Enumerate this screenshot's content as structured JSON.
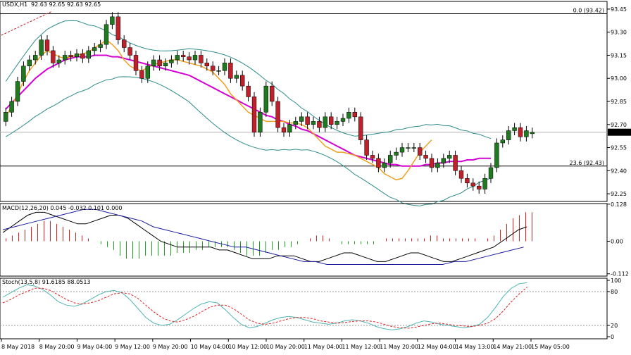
{
  "window": {
    "title": "USDX,H1",
    "ohlc": "92.63 92.65 92.63 92.65"
  },
  "colors": {
    "background": "#ffffff",
    "bull": "#1f7a1f",
    "bear": "#c0202a",
    "ma_slow": "#d400d4",
    "ma_fast": "#f0a020",
    "bands": "#2e8b8b",
    "macd_line": "#000000",
    "macd_signal": "#1a1a9e",
    "stoch_k": "#4fb3b3",
    "stoch_d": "#e02020",
    "hist_pos": "#e02020",
    "hist_neg": "#20a020"
  },
  "chart_data": [
    {
      "type": "candlestick",
      "title": "USDX,H1",
      "ylim": [
        92.2,
        93.5
      ],
      "y_ticks": [
        "93.45",
        "93.30",
        "93.15",
        "93.00",
        "92.85",
        "92.70",
        "92.55",
        "92.40",
        "92.25"
      ],
      "x_tick_labels": [
        "8 May 2018",
        "8 May 20:00",
        "9 May 04:00",
        "9 May 12:00",
        "9 May 20:00",
        "10 May 04:00",
        "10 May 12:00",
        "10 May 20:00",
        "11 May 04:00",
        "11 May 12:00",
        "11 May 20:00",
        "12 May 04:00",
        "14 May 13:00",
        "14 May 21:00",
        "15 May 05:00"
      ],
      "current_price": "92.65",
      "fibonacci": [
        {
          "label": "0.0 (93.42)",
          "value": 93.42
        },
        {
          "label": "23.6 (92.43)",
          "value": 92.43
        }
      ],
      "close": [
        92.78,
        92.85,
        92.98,
        93.08,
        93.12,
        93.15,
        93.25,
        93.18,
        93.1,
        93.12,
        93.15,
        93.14,
        93.16,
        93.13,
        93.18,
        93.2,
        93.22,
        93.35,
        93.4,
        93.25,
        93.2,
        93.15,
        93.05,
        93.0,
        93.08,
        93.12,
        93.08,
        93.1,
        93.12,
        93.15,
        93.14,
        93.12,
        93.15,
        93.1,
        93.08,
        93.05,
        93.05,
        93.1,
        93.0,
        93.02,
        92.95,
        92.88,
        92.65,
        92.78,
        92.95,
        92.85,
        92.68,
        92.65,
        92.7,
        92.72,
        92.75,
        92.7,
        92.72,
        92.68,
        92.75,
        92.7,
        92.72,
        92.74,
        92.78,
        92.75,
        92.6,
        92.5,
        92.48,
        92.42,
        92.45,
        92.5,
        92.52,
        92.55,
        92.55,
        92.55,
        92.5,
        92.48,
        92.42,
        92.45,
        92.48,
        92.5,
        92.4,
        92.35,
        92.32,
        92.3,
        92.28,
        92.35,
        92.42,
        92.58,
        92.6,
        92.66,
        92.68,
        92.62,
        92.66,
        92.65
      ],
      "open": [
        92.72,
        92.78,
        92.85,
        92.98,
        93.08,
        93.12,
        93.15,
        93.25,
        93.18,
        93.1,
        93.12,
        93.15,
        93.14,
        93.16,
        93.13,
        93.18,
        93.2,
        93.22,
        93.35,
        93.4,
        93.25,
        93.2,
        93.15,
        93.05,
        93.0,
        93.08,
        93.12,
        93.08,
        93.1,
        93.12,
        93.15,
        93.14,
        93.12,
        93.15,
        93.1,
        93.08,
        93.05,
        93.05,
        93.1,
        93.0,
        93.02,
        92.95,
        92.88,
        92.65,
        92.78,
        92.95,
        92.85,
        92.68,
        92.65,
        92.7,
        92.72,
        92.75,
        92.7,
        92.72,
        92.68,
        92.75,
        92.7,
        92.72,
        92.74,
        92.78,
        92.75,
        92.6,
        92.5,
        92.48,
        92.42,
        92.45,
        92.5,
        92.52,
        92.55,
        92.55,
        92.55,
        92.5,
        92.48,
        92.42,
        92.45,
        92.48,
        92.5,
        92.4,
        92.35,
        92.32,
        92.3,
        92.28,
        92.35,
        92.42,
        92.58,
        92.6,
        92.66,
        92.68,
        92.62,
        92.64
      ],
      "ma_slow": [
        92.8,
        92.84,
        92.88,
        92.92,
        92.96,
        93.0,
        93.03,
        93.06,
        93.08,
        93.1,
        93.12,
        93.13,
        93.14,
        93.14,
        93.14,
        93.15,
        93.15,
        93.15,
        93.14,
        93.14,
        93.13,
        93.12,
        93.11,
        93.1,
        93.09,
        93.08,
        93.07,
        93.06,
        93.05,
        93.04,
        93.03,
        93.02,
        93.0,
        92.98,
        92.96,
        92.94,
        92.92,
        92.9,
        92.88,
        92.86,
        92.84,
        92.82,
        92.8,
        92.78,
        92.76,
        92.75,
        92.73,
        92.72,
        92.7,
        92.69,
        92.67,
        92.66,
        92.64,
        92.62,
        92.6,
        92.58,
        92.56,
        92.54,
        92.52,
        92.5,
        92.49,
        92.48,
        92.47,
        92.46,
        92.45,
        92.44,
        92.44,
        92.43,
        92.43,
        92.43,
        92.43,
        92.44,
        92.44,
        92.45,
        92.45,
        92.46,
        92.46,
        92.46,
        92.47,
        92.47,
        92.48,
        92.48,
        92.48
      ],
      "ma_fast": [
        92.75,
        92.82,
        92.9,
        92.98,
        93.05,
        93.1,
        93.15,
        93.18,
        93.16,
        93.14,
        93.13,
        93.14,
        93.15,
        93.16,
        93.17,
        93.2,
        93.22,
        93.25,
        93.22,
        93.18,
        93.12,
        93.08,
        93.06,
        93.05,
        93.07,
        93.09,
        93.1,
        93.11,
        93.12,
        93.12,
        93.11,
        93.1,
        93.09,
        93.08,
        93.06,
        93.04,
        93.0,
        92.96,
        92.9,
        92.86,
        92.82,
        92.78,
        92.76,
        92.74,
        92.72,
        92.72,
        92.72,
        92.72,
        92.71,
        92.71,
        92.7,
        92.68,
        92.64,
        92.6,
        92.56,
        92.54,
        92.52,
        92.52,
        92.51,
        92.5,
        92.48,
        92.46,
        92.44,
        92.42,
        92.38,
        92.36,
        92.34,
        92.35,
        92.4,
        92.46,
        92.52,
        92.56,
        92.6
      ]
    },
    {
      "type": "line",
      "title": "MACD(12,26,20) 0.045 -0.032 0.101 0.000",
      "ylim": [
        -0.12,
        0.13
      ],
      "y_ticks": [
        "0.128",
        "0.00",
        "-0.112"
      ],
      "histogram": [
        0.01,
        0.02,
        0.03,
        0.04,
        0.05,
        0.06,
        0.07,
        0.07,
        0.06,
        0.05,
        0.04,
        0.03,
        0.02,
        0.01,
        0.0,
        -0.01,
        -0.02,
        -0.03,
        -0.05,
        -0.06,
        -0.06,
        -0.06,
        -0.05,
        -0.05,
        -0.05,
        -0.05,
        -0.05,
        -0.04,
        -0.04,
        -0.04,
        -0.03,
        -0.03,
        -0.02,
        -0.02,
        -0.02,
        -0.02,
        -0.03,
        -0.04,
        -0.05,
        -0.05,
        -0.05,
        -0.04,
        -0.03,
        -0.03,
        -0.02,
        -0.02,
        -0.01,
        0.0,
        0.01,
        0.02,
        0.02,
        0.01,
        0.0,
        -0.01,
        -0.01,
        -0.01,
        -0.01,
        -0.01,
        -0.01,
        0.0,
        0.01,
        0.01,
        0.01,
        0.01,
        0.01,
        0.01,
        0.01,
        0.02,
        0.02,
        0.01,
        0.01,
        0.01,
        0.01,
        0.01,
        0.01,
        0.0,
        0.01,
        0.02,
        0.04,
        0.06,
        0.08,
        0.09,
        0.1,
        0.1
      ],
      "macd": [
        0.03,
        0.05,
        0.07,
        0.09,
        0.1,
        0.1,
        0.09,
        0.08,
        0.07,
        0.06,
        0.06,
        0.07,
        0.08,
        0.09,
        0.09,
        0.08,
        0.06,
        0.04,
        0.02,
        0.0,
        -0.01,
        -0.02,
        -0.02,
        -0.02,
        -0.02,
        -0.02,
        -0.03,
        -0.03,
        -0.04,
        -0.05,
        -0.06,
        -0.06,
        -0.06,
        -0.05,
        -0.05,
        -0.05,
        -0.06,
        -0.07,
        -0.07,
        -0.06,
        -0.05,
        -0.04,
        -0.04,
        -0.05,
        -0.06,
        -0.07,
        -0.07,
        -0.06,
        -0.05,
        -0.04,
        -0.04,
        -0.05,
        -0.06,
        -0.07,
        -0.07,
        -0.06,
        -0.05,
        -0.04,
        -0.03,
        -0.02,
        0.0,
        0.02,
        0.04,
        0.05
      ],
      "signal": [
        0.04,
        0.05,
        0.06,
        0.07,
        0.08,
        0.09,
        0.1,
        0.11,
        0.11,
        0.1,
        0.09,
        0.08,
        0.07,
        0.05,
        0.04,
        0.03,
        0.02,
        0.01,
        0.0,
        -0.01,
        -0.02,
        -0.02,
        -0.03,
        -0.04,
        -0.05,
        -0.06,
        -0.07,
        -0.07,
        -0.08,
        -0.08,
        -0.08,
        -0.08,
        -0.08,
        -0.08,
        -0.08,
        -0.08,
        -0.08,
        -0.08,
        -0.08,
        -0.07,
        -0.07,
        -0.06,
        -0.05,
        -0.04,
        -0.03,
        -0.02
      ]
    },
    {
      "type": "line",
      "title": "Stoch(13,5,8) 91.6185 88.0513",
      "ylim": [
        0,
        100
      ],
      "y_ticks": [
        "100",
        "80",
        "20",
        "0"
      ],
      "k": [
        70,
        78,
        86,
        92,
        90,
        84,
        74,
        62,
        56,
        54,
        58,
        66,
        74,
        80,
        82,
        78,
        66,
        50,
        34,
        24,
        20,
        22,
        30,
        40,
        50,
        58,
        62,
        60,
        48,
        34,
        22,
        16,
        18,
        24,
        30,
        34,
        36,
        34,
        30,
        26,
        24,
        22,
        24,
        28,
        30,
        28,
        24,
        18,
        14,
        12,
        14,
        18,
        24,
        28,
        26,
        22,
        20,
        18,
        16,
        18,
        22,
        34,
        52,
        72,
        86,
        94,
        96
      ],
      "d": [
        60,
        66,
        74,
        80,
        86,
        86,
        82,
        74,
        66,
        60,
        58,
        60,
        64,
        70,
        76,
        78,
        76,
        68,
        56,
        44,
        34,
        28,
        26,
        30,
        36,
        44,
        52,
        56,
        56,
        50,
        40,
        30,
        24,
        22,
        24,
        28,
        32,
        34,
        34,
        32,
        28,
        26,
        24,
        25,
        27,
        28,
        28,
        26,
        22,
        18,
        16,
        15,
        17,
        20,
        23,
        24,
        22,
        20,
        19,
        18,
        20,
        24,
        32,
        46,
        62,
        76,
        88
      ]
    }
  ]
}
